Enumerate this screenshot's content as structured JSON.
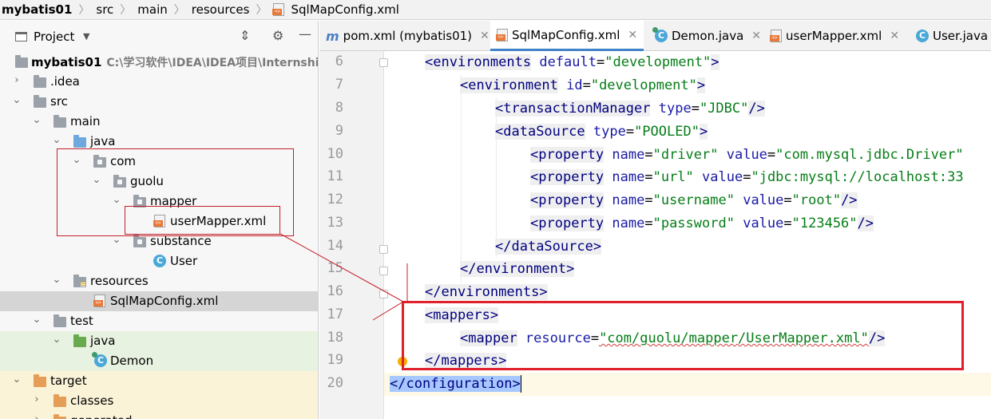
{
  "breadcrumb": {
    "project": "mybatis01",
    "items": [
      "src",
      "main",
      "resources"
    ],
    "file": "SqlMapConfig.xml"
  },
  "project_panel": {
    "title": "Project",
    "icons": [
      "gear-icon",
      "minimize-icon",
      "collapse-icon"
    ]
  },
  "tree": {
    "root_label": "mybatis01",
    "root_path": "C:\\学习软件\\IDEA\\IDEA项目\\Internship p",
    "idea": ".idea",
    "src": "src",
    "main": "main",
    "java": "java",
    "com": "com",
    "guolu": "guolu",
    "mapper": "mapper",
    "usermapper": "userMapper.xml",
    "substance": "substance",
    "user": "User",
    "resources": "resources",
    "sqlmapconfig": "SqlMapConfig.xml",
    "test": "test",
    "test_java": "java",
    "demon": "Demon",
    "target": "target",
    "classes": "classes",
    "generated": "generated"
  },
  "tabs": [
    {
      "label": "pom.xml (mybatis01)",
      "icon": "maven-icon"
    },
    {
      "label": "SqlMapConfig.xml",
      "icon": "xml-icon"
    },
    {
      "label": "Demon.java",
      "icon": "class-icon"
    },
    {
      "label": "userMapper.xml",
      "icon": "xml-icon"
    },
    {
      "label": "User.java",
      "icon": "class-icon"
    }
  ],
  "editor": {
    "line_numbers": [
      "6",
      "7",
      "8",
      "9",
      "10",
      "11",
      "12",
      "13",
      "14",
      "15",
      "16",
      "17",
      "18",
      "19",
      "20"
    ],
    "code": {
      "l6_tag": "environments",
      "l6_attr": "default",
      "l6_val": "\"development\"",
      "l7_tag": "environment",
      "l7_attr": "id",
      "l7_val": "\"development\"",
      "l8_tag": "transactionManager",
      "l8_attr": "type",
      "l8_val": "\"JDBC\"",
      "l9_tag": "dataSource",
      "l9_attr": "type",
      "l9_val": "\"POOLED\"",
      "l10_tag": "property",
      "l10_attr1": "name",
      "l10_val1": "\"driver\"",
      "l10_attr2": "value",
      "l10_val2": "\"com.mysql.jdbc.Driver\"",
      "l11_tag": "property",
      "l11_attr1": "name",
      "l11_val1": "\"url\"",
      "l11_attr2": "value",
      "l11_val2": "\"jdbc:mysql://localhost:33",
      "l12_tag": "property",
      "l12_attr1": "name",
      "l12_val1": "\"username\"",
      "l12_attr2": "value",
      "l12_val2": "\"root\"",
      "l13_tag": "property",
      "l13_attr1": "name",
      "l13_val1": "\"password\"",
      "l13_attr2": "value",
      "l13_val2": "\"123456\"",
      "l14_tag": "dataSource",
      "l15_tag": "environment",
      "l16_tag": "environments",
      "l17_tag": "mappers",
      "l18_tag": "mapper",
      "l18_attr": "resource",
      "l18_val": "\"com/guolu/mapper/UserMapper.xml\"",
      "l19_tag": "mappers",
      "l20_tag": "configuration"
    }
  },
  "colors": {
    "tag": "#000080",
    "attribute": "#1a1aa6",
    "value": "#067d17",
    "annotation": "#e0212b",
    "selection": "#a6c8ff"
  }
}
